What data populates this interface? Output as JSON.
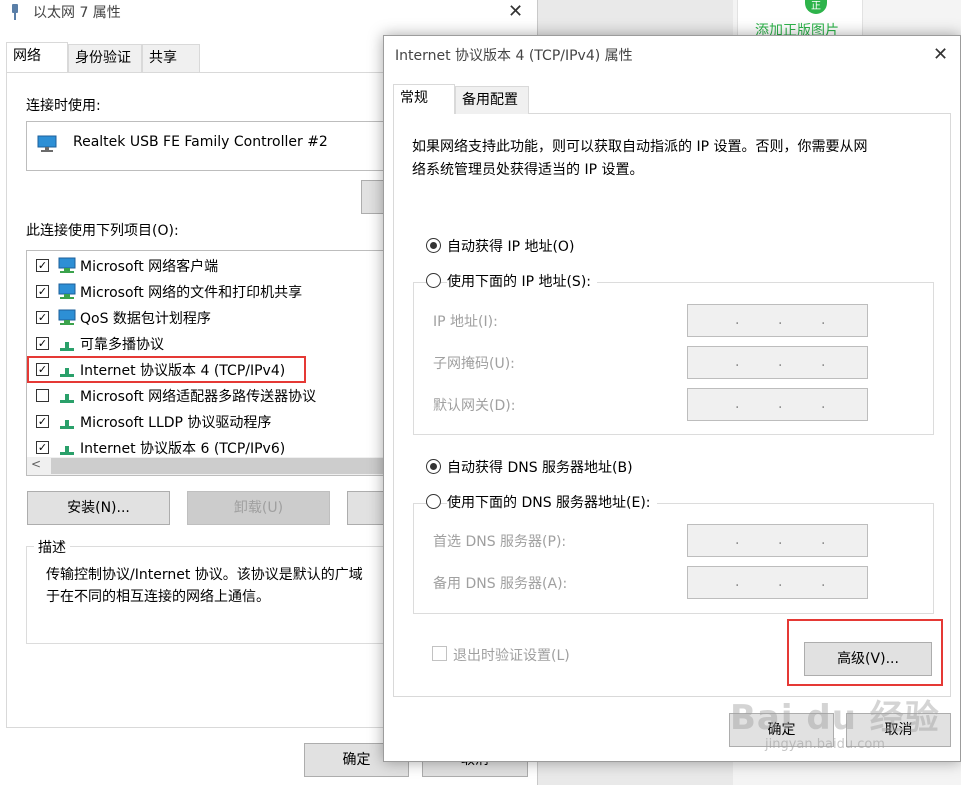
{
  "background": {
    "add_label": "添加正版图片",
    "badge": "正"
  },
  "ethernet_dialog": {
    "title": "以太网 7 属性",
    "close_glyph": "✕",
    "tabs": [
      "网络",
      "身份验证",
      "共享"
    ],
    "connect_using_label": "连接时使用:",
    "adapter_name": "Realtek USB FE Family Controller #2",
    "items_label": "此连接使用下列项目(O):",
    "items": [
      {
        "checked": true,
        "label": "Microsoft 网络客户端",
        "icon": "network-client-icon"
      },
      {
        "checked": true,
        "label": "Microsoft 网络的文件和打印机共享",
        "icon": "file-sharing-icon"
      },
      {
        "checked": true,
        "label": "QoS 数据包计划程序",
        "icon": "qos-icon"
      },
      {
        "checked": true,
        "label": "可靠多播协议",
        "icon": "protocol-icon"
      },
      {
        "checked": true,
        "label": "Internet 协议版本 4 (TCP/IPv4)",
        "icon": "protocol-icon"
      },
      {
        "checked": false,
        "label": "Microsoft 网络适配器多路传送器协议",
        "icon": "protocol-icon"
      },
      {
        "checked": true,
        "label": "Microsoft LLDP 协议驱动程序",
        "icon": "protocol-icon"
      },
      {
        "checked": true,
        "label": "Internet 协议版本 6 (TCP/IPv6)",
        "icon": "protocol-icon"
      }
    ],
    "install_button": "安装(N)...",
    "uninstall_button": "卸载(U)",
    "description_legend": "描述",
    "description_line1": "传输控制协议/Internet 协议。该协议是默认的广域",
    "description_line2": "于在不同的相互连接的网络上通信。",
    "ok_button": "确定",
    "cancel_button": "取消"
  },
  "ipv4_dialog": {
    "title": "Internet 协议版本 4 (TCP/IPv4) 属性",
    "close_glyph": "✕",
    "tabs": [
      "常规",
      "备用配置"
    ],
    "intro_line1": "如果网络支持此功能，则可以获取自动指派的 IP 设置。否则，你需要从网",
    "intro_line2": "络系统管理员处获得适当的 IP 设置。",
    "auto_ip_label": "自动获得 IP 地址(O)",
    "manual_ip_label": "使用下面的 IP 地址(S):",
    "ip_address_label": "IP 地址(I):",
    "subnet_label": "子网掩码(U):",
    "gateway_label": "默认网关(D):",
    "auto_dns_label": "自动获得 DNS 服务器地址(B)",
    "manual_dns_label": "使用下面的 DNS 服务器地址(E):",
    "preferred_dns_label": "首选 DNS 服务器(P):",
    "alternate_dns_label": "备用 DNS 服务器(A):",
    "ip_dots": ".",
    "validate_label": "退出时验证设置(L)",
    "advanced_button": "高级(V)...",
    "ok_button": "确定",
    "cancel_button": "取消",
    "selected_ip_mode": "auto",
    "selected_dns_mode": "auto"
  },
  "watermark": {
    "main": "Bai du 经验",
    "sub": "jingyan.baidu.com"
  }
}
